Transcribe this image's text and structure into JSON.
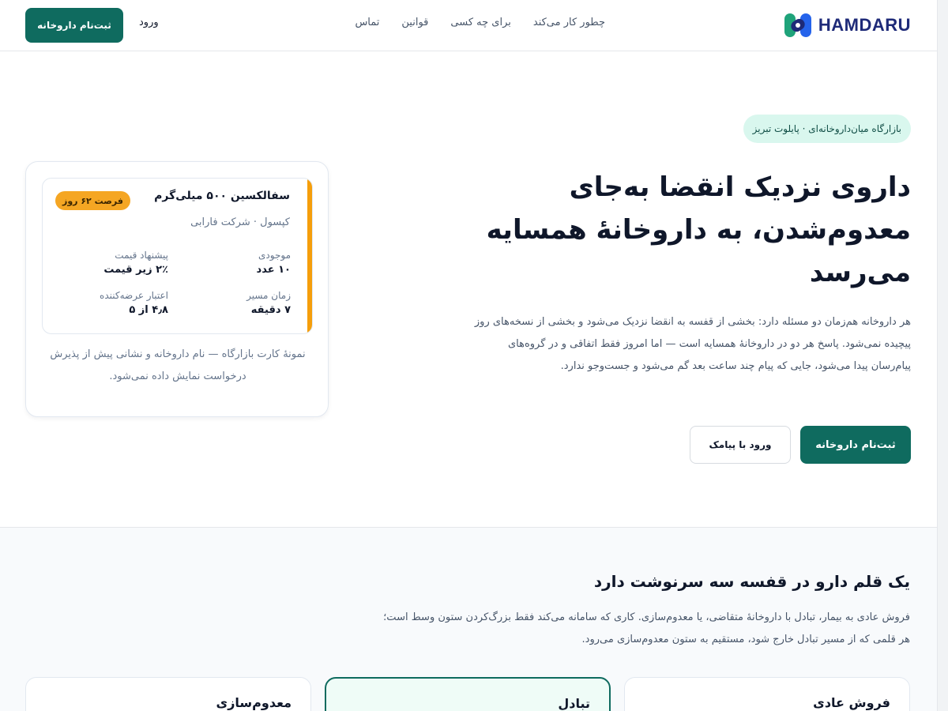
{
  "brand": {
    "name": "HAMDARU"
  },
  "nav": {
    "items": [
      "چطور کار می‌کند",
      "برای چه کسی",
      "قوانین",
      "تماس"
    ],
    "login": "ورود",
    "cta": "ثبت‌نام داروخانه"
  },
  "hero": {
    "pill": "بازارگاه میان‌داروخانه‌ای · پایلوت تبریز",
    "title": "داروی نزدیک انقضا به‌جای معدوم‌شدن، به داروخانهٔ همسایه می‌رسد",
    "description": "هر داروخانه هم‌زمان دو مسئله دارد: بخشی از قفسه به انقضا نزدیک می‌شود و بخشی از نسخه‌های روز پیچیده نمی‌شود. پاسخ هر دو در داروخانهٔ همسایه است — اما امروز فقط اتفاقی و در گروه‌های پیام‌رسان پیدا می‌شود، جایی که پیام چند ساعت بعد گم می‌شود و جست‌وجو ندارد.",
    "primary_cta": "ثبت‌نام داروخانه",
    "secondary_cta": "ورود با پیامک"
  },
  "listing_card": {
    "drug_name": "سفالکسین ۵۰۰ میلی‌گرم",
    "badge": "فرصت ۶۲ روز",
    "subtitle": "کپسول · شرکت فارابی",
    "stats": [
      {
        "label": "موجودی",
        "value": "۱۰ عدد"
      },
      {
        "label": "پیشنهاد قیمت",
        "value": "۲٪ زیر قیمت"
      },
      {
        "label": "زمان مسیر",
        "value": "۷ دقیقه"
      },
      {
        "label": "اعتبار عرضه‌کننده",
        "value": "۴٫۸ از ۵"
      }
    ],
    "caption": "نمونهٔ کارت بازارگاه — نام داروخانه و نشانی پیش از پذیرش درخواست نمایش داده نمی‌شود."
  },
  "section": {
    "title": "یک قلم دارو در قفسه سه سرنوشت دارد",
    "description": "فروش عادی به بیمار، تبادل با داروخانهٔ متقاضی، یا معدوم‌سازی. کاری که سامانه می‌کند فقط بزرگ‌کردن ستون وسط است؛ هر قلمی که از مسیر تبادل خارج شود، مستقیم به ستون معدوم‌سازی می‌رود.",
    "columns": [
      "فروش عادی",
      "تبادل",
      "معدوم‌سازی"
    ]
  },
  "colors": {
    "primary": "#0f6b5f",
    "pill_bg": "#d9f7ee",
    "badge": "#f5a623",
    "accent_bar": "#f59e0b",
    "brand_text": "#1e2a78"
  }
}
